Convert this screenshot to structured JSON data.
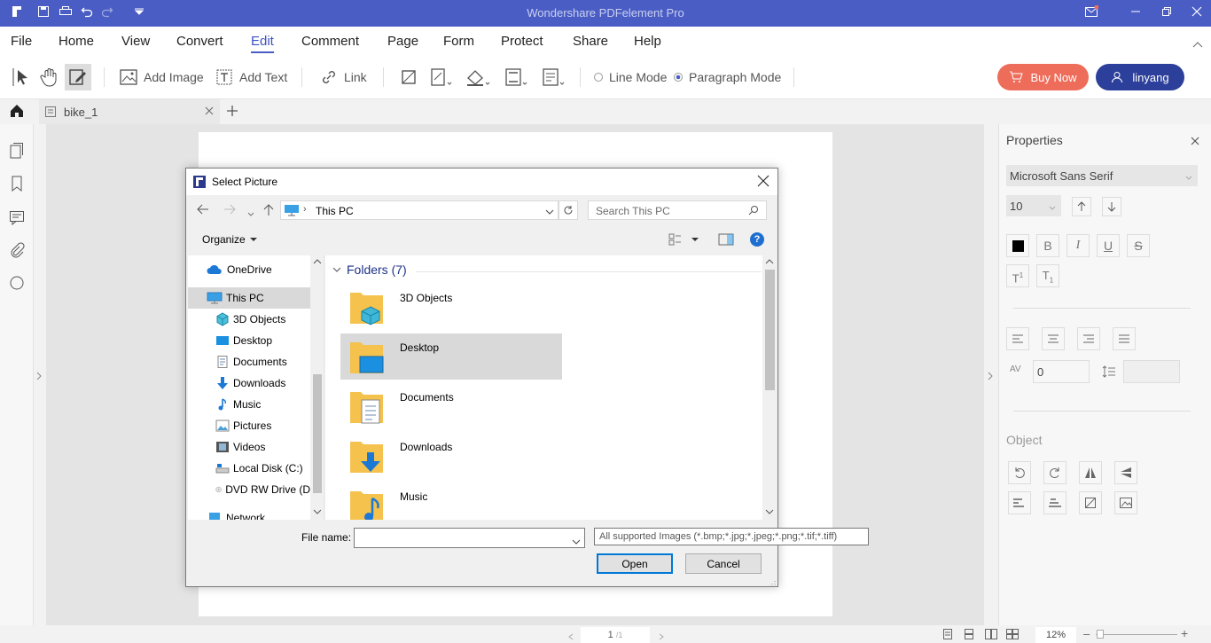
{
  "app": {
    "title": "Wondershare PDFelement Pro"
  },
  "menu": [
    "File",
    "Home",
    "View",
    "Convert",
    "Edit",
    "Comment",
    "Page",
    "Form",
    "Protect",
    "Share",
    "Help"
  ],
  "toolbar": {
    "add_image": "Add Image",
    "add_text": "Add Text",
    "link": "Link",
    "line_mode": "Line Mode",
    "paragraph_mode": "Paragraph Mode",
    "buy_now": "Buy Now",
    "user": "linyang"
  },
  "tabs": {
    "doc_name": "bike_1"
  },
  "properties": {
    "title": "Properties",
    "font": "Microsoft Sans Serif",
    "size": "10",
    "spacing": "0",
    "object_title": "Object"
  },
  "dialog": {
    "title": "Select Picture",
    "address": "This PC",
    "search_placeholder": "Search This PC",
    "organize": "Organize",
    "nav_items": [
      "OneDrive",
      "This PC",
      "3D Objects",
      "Desktop",
      "Documents",
      "Downloads",
      "Music",
      "Pictures",
      "Videos",
      "Local Disk (C:)",
      "DVD RW Drive (D",
      "Network"
    ],
    "folders_header": "Folders (7)",
    "folders": [
      "3D Objects",
      "Desktop",
      "Documents",
      "Downloads",
      "Music"
    ],
    "file_name_label": "File name:",
    "file_name_value": "",
    "filter": "All supported Images (*.bmp;*.jpg;*.jpeg;*.png;*.tif;*.tiff)",
    "open": "Open",
    "cancel": "Cancel"
  },
  "status": {
    "page": "1",
    "page_total": "/1",
    "zoom": "12%"
  },
  "colors": {
    "brand": "#4a5dc4",
    "buy": "#ee6d5a",
    "user": "#2c3f9a",
    "folder": "#f4c24d",
    "selection": "#d9d9d9"
  }
}
